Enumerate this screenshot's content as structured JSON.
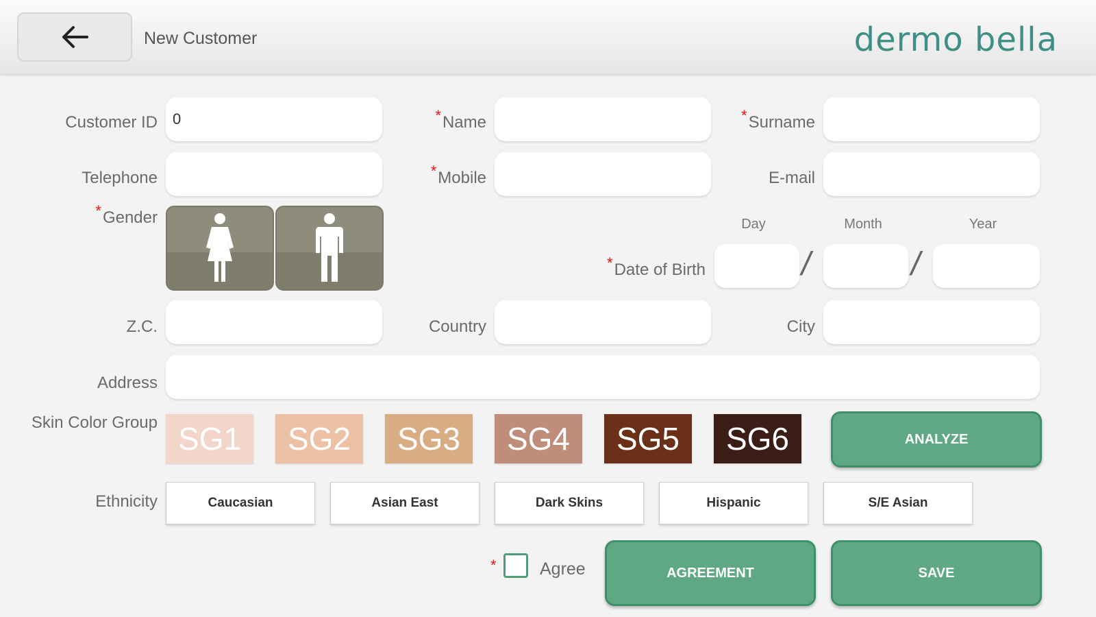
{
  "header": {
    "back_icon": "arrow-left-icon",
    "title": "New Customer",
    "brand": "dermo bella"
  },
  "form": {
    "customer_id": {
      "label": "Customer ID",
      "value": "0"
    },
    "name": {
      "label": "Name",
      "value": ""
    },
    "surname": {
      "label": "Surname",
      "value": ""
    },
    "telephone": {
      "label": "Telephone",
      "value": ""
    },
    "mobile": {
      "label": "Mobile",
      "value": ""
    },
    "email": {
      "label": "E-mail",
      "value": ""
    },
    "gender": {
      "label": "Gender",
      "options": [
        "female-icon",
        "male-icon"
      ]
    },
    "dob": {
      "label": "Date of Birth",
      "day": "Day",
      "month": "Month",
      "year": "Year",
      "separator": "/"
    },
    "zc": {
      "label": "Z.C.",
      "value": ""
    },
    "country": {
      "label": "Country",
      "value": ""
    },
    "city": {
      "label": "City",
      "value": ""
    },
    "address": {
      "label": "Address",
      "value": ""
    },
    "required_mark": "*"
  },
  "skin": {
    "label": "Skin Color Group",
    "groups": [
      {
        "label": "SG1",
        "color": "#f2d6c9"
      },
      {
        "label": "SG2",
        "color": "#ecc1a6"
      },
      {
        "label": "SG3",
        "color": "#d9ad83"
      },
      {
        "label": "SG4",
        "color": "#bf8d79"
      },
      {
        "label": "SG5",
        "color": "#6b3018"
      },
      {
        "label": "SG6",
        "color": "#3a1e16"
      }
    ],
    "analyze_label": "ANALYZE"
  },
  "ethnicity": {
    "label": "Ethnicity",
    "options": [
      "Caucasian",
      "Asian East",
      "Dark Skins",
      "Hispanic",
      "S/E Asian"
    ]
  },
  "footer": {
    "agree_label": "Agree",
    "agreement_label": "AGREEMENT",
    "save_label": "SAVE"
  },
  "colors": {
    "accent": "#5ea884",
    "brand": "#3f8f86",
    "required": "#ee1111"
  }
}
